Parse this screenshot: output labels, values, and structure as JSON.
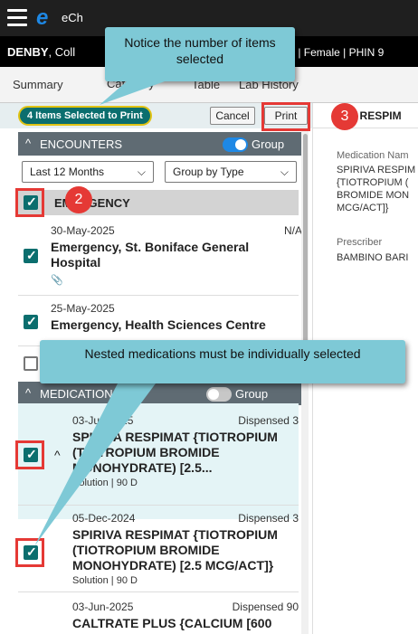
{
  "app": {
    "title": "eCh"
  },
  "patient": {
    "last_name": "DENBY",
    "first_name_fragment": ", Coll",
    "info": ") | Female | PHIN 9"
  },
  "tabs": [
    {
      "label": "Summary"
    },
    {
      "label": "Category"
    },
    {
      "label": "Table"
    },
    {
      "label": "Lab History"
    }
  ],
  "selection": {
    "count_label": "4 Items Selected to Print",
    "cancel_label": "Cancel",
    "print_label": "Print"
  },
  "encounters": {
    "header": "ENCOUNTERS",
    "toggle_label": "Group",
    "filter_time": "Last 12 Months",
    "filter_group": "Group by Type",
    "group_label": "EMERGENCY",
    "items": [
      {
        "date": "30-May-2025",
        "status": "N/A",
        "title": "Emergency, St. Boniface General Hospital"
      },
      {
        "date": "25-May-2025",
        "title": "Emergency, Health Sciences Centre"
      }
    ]
  },
  "medications": {
    "header": "MEDICATIONS",
    "toggle_label": "Group",
    "items": [
      {
        "date": "03-Jun-2025",
        "status": "Dispensed 3",
        "title": "SPIRIVA RESPIMAT {TIOTROPIUM (TIOTROPIUM BROMIDE MONOHYDRATE) [2.5...",
        "sub": "Solution | 90 D"
      },
      {
        "date": "05-Dec-2024",
        "status": "Dispensed 3",
        "title": "SPIRIVA RESPIMAT {TIOTROPIUM (TIOTROPIUM BROMIDE MONOHYDRATE) [2.5 MCG/ACT]}",
        "sub": "Solution | 90 D"
      },
      {
        "date": "03-Jun-2025",
        "status": "Dispensed 90",
        "title": "CALTRATE PLUS {CALCIUM [600"
      }
    ]
  },
  "detail": {
    "header": "A RESPIM",
    "med_name_label": "Medication Nam",
    "med_name_lines": [
      "SPIRIVA RESPIM",
      "{TIOTROPIUM (",
      "BROMIDE MON",
      "MCG/ACT]}"
    ],
    "prescriber_label": "Prescriber",
    "prescriber_value": "BAMBINO BARI"
  },
  "callouts": {
    "top": "Notice the number of items selected",
    "middle": "Nested medications must be individually selected"
  },
  "steps": {
    "two": "2",
    "three": "3"
  },
  "colors": {
    "teal": "#0b6e6e",
    "callout": "#7ec9d6",
    "red": "#e53935",
    "highlight": "#e0c313"
  }
}
